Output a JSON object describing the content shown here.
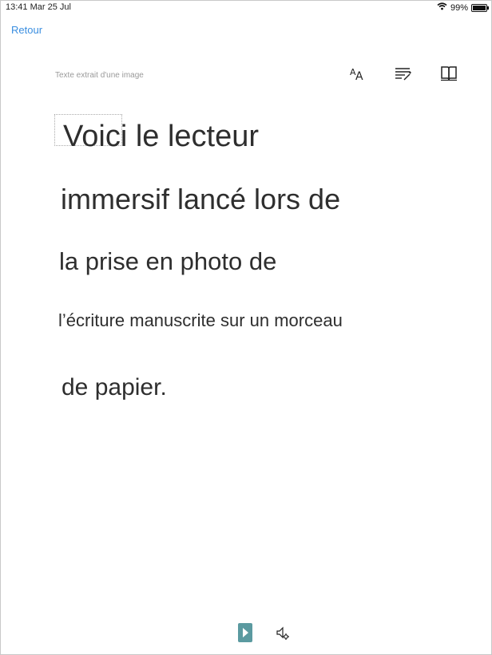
{
  "status_bar": {
    "time": "13:41",
    "date": "Mar 25 Jul",
    "battery": "99%"
  },
  "nav": {
    "back_label": "Retour"
  },
  "header": {
    "source_label": "Texte extrait d'une image"
  },
  "toolbar": {
    "icons": [
      "text-size-icon",
      "text-options-icon",
      "reading-preferences-icon"
    ]
  },
  "reader": {
    "lines": [
      "Voici le lecteur",
      "immersif lancé lors de",
      "la prise en photo de",
      "l’écriture manuscrite sur un morceau",
      "de papier."
    ]
  },
  "bottom": {
    "icons": [
      "play-icon",
      "voice-settings-icon"
    ]
  },
  "colors": {
    "accent": "#3a8ee0",
    "play": "#5b9aa0",
    "text": "#2e2e2e"
  }
}
